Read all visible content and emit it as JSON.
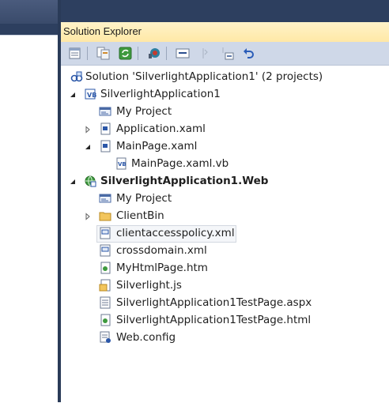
{
  "panel": {
    "title": "Solution Explorer"
  },
  "toolbar": {
    "buttons": [
      {
        "name": "properties-button",
        "icon": "properties-icon"
      },
      {
        "name": "show-all-files-button",
        "icon": "show-all-files-icon"
      },
      {
        "name": "refresh-button",
        "icon": "refresh-icon"
      },
      {
        "name": "view-class-diagram-button",
        "icon": "class-diagram-icon"
      },
      {
        "name": "view-code-button",
        "icon": "view-code-icon"
      },
      {
        "name": "view-designer-button",
        "icon": "view-designer-icon"
      },
      {
        "name": "nest-related-files-button",
        "icon": "nest-files-icon"
      },
      {
        "name": "undo-button",
        "icon": "undo-icon"
      }
    ]
  },
  "tree": {
    "solution": "Solution 'SilverlightApplication1' (2 projects)",
    "project1": "SilverlightApplication1",
    "p1_myproject": "My Project",
    "p1_appxaml": "Application.xaml",
    "p1_mainpage": "MainPage.xaml",
    "p1_mainpage_vb": "MainPage.xaml.vb",
    "project2": "SilverlightApplication1.Web",
    "p2_myproject": "My Project",
    "p2_clientbin": "ClientBin",
    "p2_clientaccess": "clientaccesspolicy.xml",
    "p2_crossdomain": "crossdomain.xml",
    "p2_myhtml": "MyHtmlPage.htm",
    "p2_silverlightjs": "Silverlight.js",
    "p2_testaspx": "SilverlightApplication1TestPage.aspx",
    "p2_testhtml": "SilverlightApplication1TestPage.html",
    "p2_webconfig": "Web.config"
  },
  "colors": {
    "chrome_dark": "#2d3f5f",
    "title_gradient_top": "#fff3c9",
    "title_gradient_bottom": "#ffe8a6",
    "toolbar_bg": "#cfd8e8"
  }
}
